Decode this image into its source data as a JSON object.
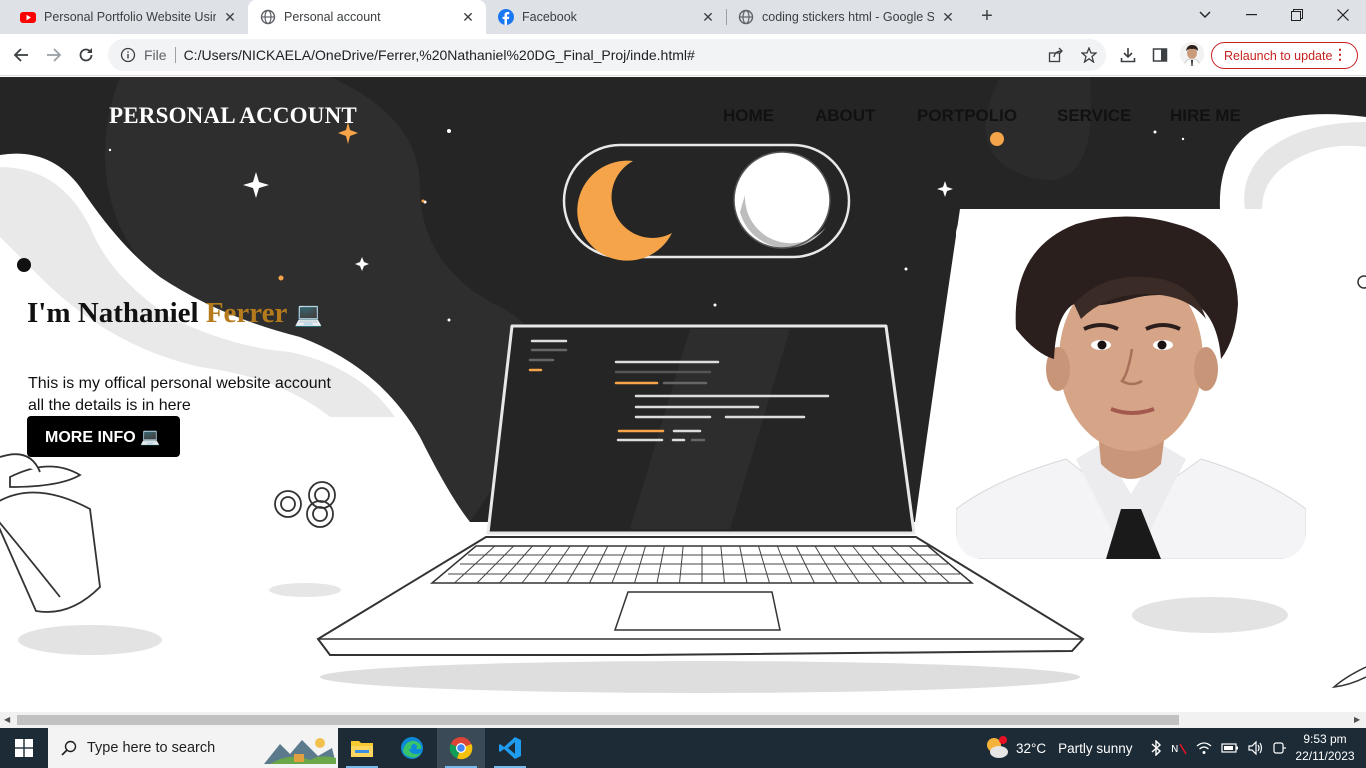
{
  "browser": {
    "tabs": [
      {
        "title": "Personal Portfolio Website Using",
        "icon": "youtube-icon"
      },
      {
        "title": "Personal account",
        "icon": "globe-icon"
      },
      {
        "title": "Facebook",
        "icon": "facebook-icon"
      },
      {
        "title": "coding stickers html - Google Se",
        "icon": "globe-icon"
      }
    ],
    "close_glyph": "✕",
    "new_tab_glyph": "+",
    "address": {
      "scheme_label": "File",
      "url": "C:/Users/NICKAELA/OneDrive/Ferrer,%20Nathaniel%20DG_Final_Proj/inde.html#"
    },
    "relaunch_label": "Relaunch to update",
    "accent_color": "#c5221f"
  },
  "site": {
    "logo": "PERSONAL ACCOUNT",
    "nav": [
      "HOME",
      "ABOUT",
      "PORTPOLIO",
      "SERVICE",
      "HIRE ME"
    ],
    "hero": {
      "greeting": "I'm Nathaniel",
      "accent_name": "Ferrer",
      "emoji": "💻",
      "line1": "This is my offical personal website account",
      "line2": "all the details is in here",
      "button_label": "MORE INFO 💻"
    },
    "accent_color": "#b57a1c"
  },
  "taskbar": {
    "search_placeholder": "Type here to search",
    "weather_temp": "32°C",
    "weather_text": "Partly sunny",
    "time": "9:53 pm",
    "date": "22/11/2023"
  }
}
